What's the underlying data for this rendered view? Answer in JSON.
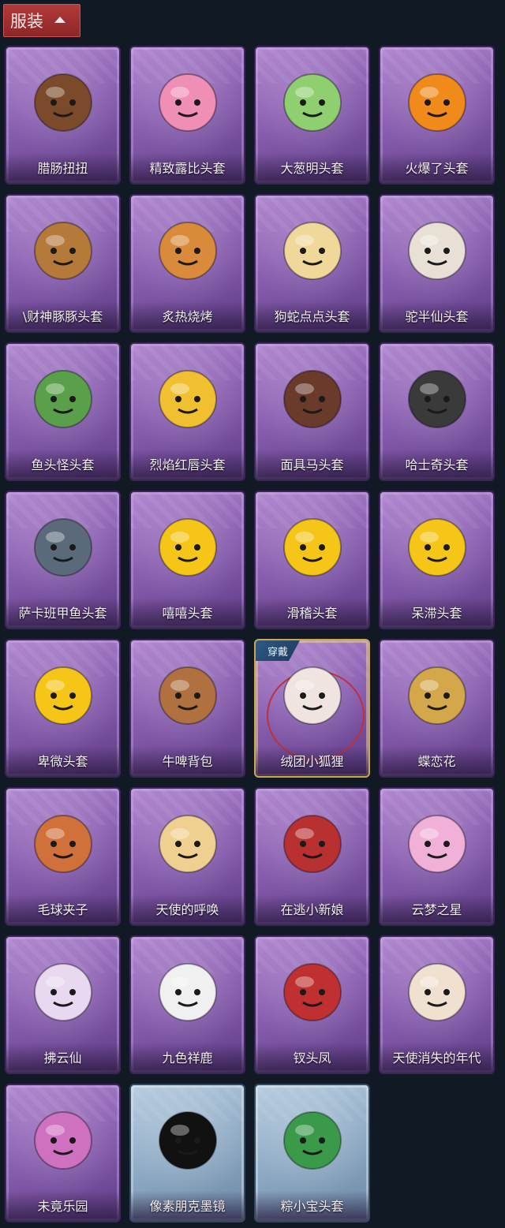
{
  "header": {
    "title": "服装"
  },
  "equipped_badge": "穿戴",
  "items": [
    {
      "label": "腊肠扭扭",
      "icon": "dog-head-icon",
      "color": "#7a4a2a"
    },
    {
      "label": "精致露比头套",
      "icon": "pink-pig-head-icon",
      "color": "#f08fb5"
    },
    {
      "label": "大葱明头套",
      "icon": "green-onion-head-icon",
      "color": "#8fcf6f"
    },
    {
      "label": "火爆了头套",
      "icon": "fire-head-icon",
      "color": "#f08a1a"
    },
    {
      "label": "\\财神豚豚头套",
      "icon": "capybara-head-icon",
      "color": "#b5793a"
    },
    {
      "label": "炙热烧烤",
      "icon": "bone-meat-head-icon",
      "color": "#d98a3a"
    },
    {
      "label": "狗蛇点点头套",
      "icon": "snake-head-icon",
      "color": "#f0d89a"
    },
    {
      "label": "驼半仙头套",
      "icon": "alpaca-head-icon",
      "color": "#e8e0d4"
    },
    {
      "label": "鱼头怪头套",
      "icon": "fish-head-icon",
      "color": "#5aa04a"
    },
    {
      "label": "烈焰红唇头套",
      "icon": "pikachu-mask-icon",
      "color": "#f0c030"
    },
    {
      "label": "面具马头套",
      "icon": "horse-head-icon",
      "color": "#6a3a2a"
    },
    {
      "label": "哈士奇头套",
      "icon": "husky-head-icon",
      "color": "#3a3a3a"
    },
    {
      "label": "萨卡班甲鱼头套",
      "icon": "fish-ball-icon",
      "color": "#5a6a7a"
    },
    {
      "label": "嘻嘻头套",
      "icon": "grin-emoji-icon",
      "color": "#f5c518"
    },
    {
      "label": "滑稽头套",
      "icon": "smirk-emoji-icon",
      "color": "#f5c518"
    },
    {
      "label": "呆滞头套",
      "icon": "stare-emoji-icon",
      "color": "#f5c518"
    },
    {
      "label": "卑微头套",
      "icon": "humble-emoji-icon",
      "color": "#f5c518"
    },
    {
      "label": "牛啤背包",
      "icon": "beer-cow-backpack-icon",
      "color": "#b07040"
    },
    {
      "label": "绒团小狐狸",
      "icon": "fox-plush-icon",
      "color": "#f0e4e0",
      "equipped": true
    },
    {
      "label": "蝶恋花",
      "icon": "butterfly-wreath-icon",
      "color": "#d4a84a"
    },
    {
      "label": "毛球夹子",
      "icon": "raccoon-drummer-icon",
      "color": "#d0703a"
    },
    {
      "label": "天使的呼唤",
      "icon": "angel-doll-icon",
      "color": "#f0d090"
    },
    {
      "label": "在逃小新娘",
      "icon": "mushroom-bride-icon",
      "color": "#b83030"
    },
    {
      "label": "云梦之星",
      "icon": "unicorn-cloud-icon",
      "color": "#f0b0d8"
    },
    {
      "label": "拂云仙",
      "icon": "fairy-charm-icon",
      "color": "#e8d8f0"
    },
    {
      "label": "九色祥鹿",
      "icon": "deer-charm-icon",
      "color": "#f0f0f0"
    },
    {
      "label": "钗头凤",
      "icon": "phoenix-princess-icon",
      "color": "#c03030"
    },
    {
      "label": "天使消失的年代",
      "icon": "sleeping-angel-icon",
      "color": "#f0e0d0"
    },
    {
      "label": "未竟乐园",
      "icon": "star-girl-icon",
      "color": "#d070c0"
    },
    {
      "label": "像素朋克墨镜",
      "icon": "pixel-sunglasses-icon",
      "color": "#111111",
      "variant": "blue"
    },
    {
      "label": "粽小宝头套",
      "icon": "zongzi-head-icon",
      "color": "#3a9a4a",
      "variant": "blue"
    }
  ]
}
